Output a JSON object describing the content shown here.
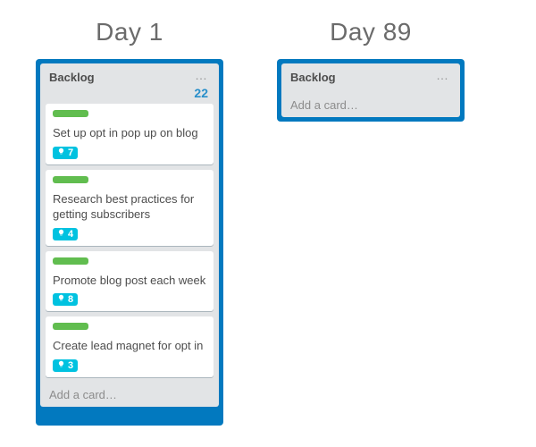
{
  "columns": [
    {
      "title": "Day 1"
    },
    {
      "title": "Day 89"
    }
  ],
  "left": {
    "list_title": "Backlog",
    "menu": "…",
    "count": "22",
    "add_card": "Add a card…",
    "cards": [
      {
        "label_color": "#61bd4f",
        "text": "Set up opt in pop up on blog",
        "badge": "7"
      },
      {
        "label_color": "#61bd4f",
        "text": "Research best practices for getting subscribers",
        "badge": "4"
      },
      {
        "label_color": "#61bd4f",
        "text": "Promote blog post each week",
        "badge": "8"
      },
      {
        "label_color": "#61bd4f",
        "text": "Create lead magnet for opt in",
        "badge": "3"
      }
    ]
  },
  "right": {
    "list_title": "Backlog",
    "menu": "…",
    "add_card": "Add a card…"
  }
}
